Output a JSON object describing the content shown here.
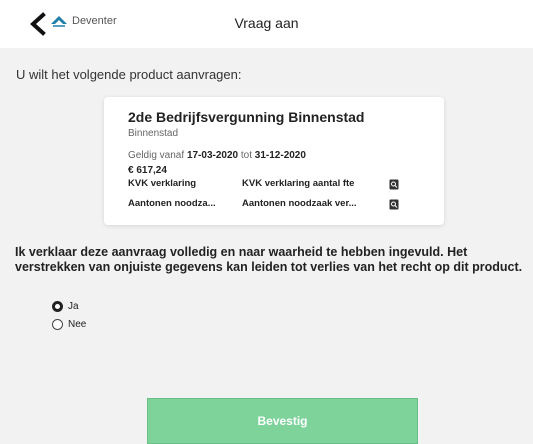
{
  "header": {
    "city": "Deventer",
    "title": "Vraag aan"
  },
  "intro": "U wilt het volgende product aanvragen:",
  "product": {
    "name": "2de Bedrijfsvergunning Binnenstad",
    "zone": "Binnenstad",
    "valid_from_label": "Geldig vanaf",
    "valid_from": "17-03-2020",
    "valid_to_label": "tot",
    "valid_to": "31-12-2020",
    "price": "€ 617,24",
    "documents": [
      {
        "col1": "KVK verklaring",
        "col2": "KVK verklaring aantal fte"
      },
      {
        "col1": "Aantonen noodza...",
        "col2": "Aantonen noodzaak ver..."
      }
    ]
  },
  "declaration": "Ik verklaar deze aanvraag volledig en naar waarheid te hebben ingevuld. Het verstrekken van onjuiste gegevens kan leiden tot verlies van het recht op dit product.",
  "options": [
    {
      "label": "Ja",
      "selected": true
    },
    {
      "label": "Nee",
      "selected": false
    }
  ],
  "confirm_label": "Bevestig",
  "colors": {
    "accent": "#7dd39a",
    "logo": "#1f7fa8"
  }
}
